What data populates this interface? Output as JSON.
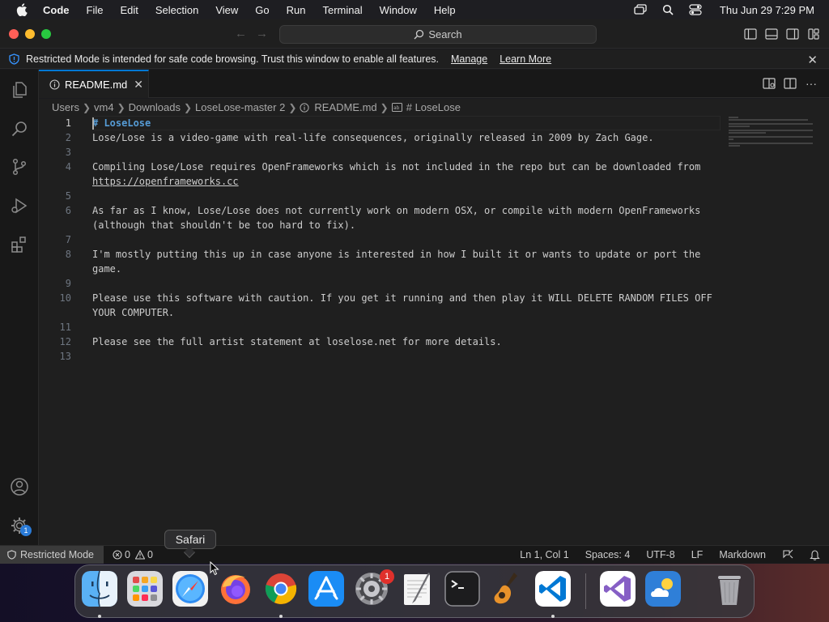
{
  "menubar": {
    "app": "Code",
    "items": [
      "File",
      "Edit",
      "Selection",
      "View",
      "Go",
      "Run",
      "Terminal",
      "Window",
      "Help"
    ],
    "clock": "Thu Jun 29  7:29 PM"
  },
  "titlebar": {
    "search_label": "Search"
  },
  "banner": {
    "message": "Restricted Mode is intended for safe code browsing. Trust this window to enable all features.",
    "manage_link": "Manage",
    "learn_link": "Learn More"
  },
  "tab": {
    "filename": "README.md"
  },
  "breadcrumbs": [
    "Users",
    "vm4",
    "Downloads",
    "LoseLose-master 2",
    "README.md",
    "# LoseLose"
  ],
  "editor": {
    "lines": [
      {
        "no": "1",
        "text": "# LoseLose",
        "kind": "heading"
      },
      {
        "no": "2",
        "text": "Lose/Lose is a video-game with real-life consequences, originally released in 2009 by Zach Gage.",
        "kind": "text"
      },
      {
        "no": "3",
        "text": "",
        "kind": "text"
      },
      {
        "no": "4",
        "text": "Compiling Lose/Lose requires OpenFrameworks which is not included in the repo but can be downloaded from",
        "kind": "text"
      },
      {
        "no": "",
        "text": "https://openframeworks.cc",
        "kind": "link"
      },
      {
        "no": "5",
        "text": "",
        "kind": "text"
      },
      {
        "no": "6",
        "text": "As far as I know, Lose/Lose does not currently work on modern OSX, or compile with modern OpenFrameworks",
        "kind": "text"
      },
      {
        "no": "",
        "text": "(although that shouldn't be too hard to fix).",
        "kind": "text"
      },
      {
        "no": "7",
        "text": "",
        "kind": "text"
      },
      {
        "no": "8",
        "text": "I'm mostly putting this up in case anyone is interested in how I built it or wants to update or port the",
        "kind": "text"
      },
      {
        "no": "",
        "text": "game.",
        "kind": "text"
      },
      {
        "no": "9",
        "text": "",
        "kind": "text"
      },
      {
        "no": "10",
        "text": "Please use this software with caution. If you get it running and then play it WILL DELETE RANDOM FILES OFF",
        "kind": "text"
      },
      {
        "no": "",
        "text": "YOUR COMPUTER.",
        "kind": "text"
      },
      {
        "no": "11",
        "text": "",
        "kind": "text"
      },
      {
        "no": "12",
        "text": "Please see the full artist statement at loselose.net for more details.",
        "kind": "text"
      },
      {
        "no": "13",
        "text": "",
        "kind": "text"
      }
    ]
  },
  "activity": {
    "settings_badge": "1"
  },
  "statusbar": {
    "restricted": "Restricted Mode",
    "errors": "0",
    "warnings": "0",
    "position": "Ln 1, Col 1",
    "spaces": "Spaces: 4",
    "encoding": "UTF-8",
    "eol": "LF",
    "language": "Markdown"
  },
  "tooltip": "Safari",
  "dock": {
    "apps": [
      "Finder",
      "Launchpad",
      "Safari",
      "Firefox",
      "Chrome",
      "App Store",
      "System Settings",
      "TextEdit",
      "Terminal",
      "GarageBand",
      "Visual Studio Code",
      "Visual Studio",
      "Weather",
      "Trash"
    ],
    "settings_badge": "1"
  },
  "colors": {
    "accent": "#0078d4",
    "heading": "#569cd6",
    "badge": "#2a7bd8",
    "notification": "#e0302b"
  }
}
